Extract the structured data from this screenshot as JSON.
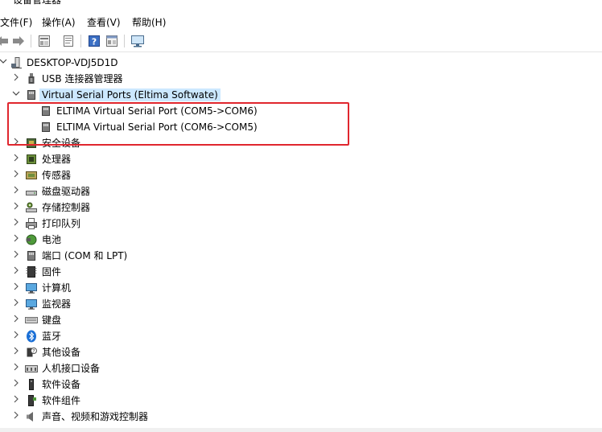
{
  "window": {
    "title": "设备管理器"
  },
  "menu": [
    {
      "label": "文件(F)"
    },
    {
      "label": "操作(A)"
    },
    {
      "label": "查看(V)"
    },
    {
      "label": "帮助(H)"
    }
  ],
  "toolbar": {
    "icons": [
      "back-arrow-icon",
      "forward-arrow-icon",
      "properties-icon",
      "update-driver-icon",
      "help-icon",
      "view-icon",
      "monitor-icon"
    ]
  },
  "tree": {
    "root": {
      "label": "DESKTOP-VDJ5D1D"
    },
    "categories": [
      {
        "label": "USB 连接器管理器",
        "expanded": false,
        "icon": "usb-icon"
      },
      {
        "label": "Virtual Serial Ports (Eltima Softwate)",
        "expanded": true,
        "icon": "port-icon",
        "children": [
          {
            "label": "ELTIMA Virtual Serial Port (COM5->COM6)"
          },
          {
            "label": "ELTIMA Virtual Serial Port (COM6->COM5)"
          }
        ]
      },
      {
        "label": "安全设备",
        "icon": "security-device-icon"
      },
      {
        "label": "处理器",
        "icon": "processor-icon"
      },
      {
        "label": "传感器",
        "icon": "sensor-icon"
      },
      {
        "label": "磁盘驱动器",
        "icon": "disk-drive-icon"
      },
      {
        "label": "存储控制器",
        "icon": "storage-controller-icon"
      },
      {
        "label": "打印队列",
        "icon": "printer-icon"
      },
      {
        "label": "电池",
        "icon": "battery-icon"
      },
      {
        "label": "端口 (COM 和 LPT)",
        "icon": "port-icon"
      },
      {
        "label": "固件",
        "icon": "firmware-icon"
      },
      {
        "label": "计算机",
        "icon": "computer-icon"
      },
      {
        "label": "监视器",
        "icon": "monitor-icon"
      },
      {
        "label": "键盘",
        "icon": "keyboard-icon"
      },
      {
        "label": "蓝牙",
        "icon": "bluetooth-icon"
      },
      {
        "label": "其他设备",
        "icon": "unknown-device-icon"
      },
      {
        "label": "人机接口设备",
        "icon": "hid-icon"
      },
      {
        "label": "软件设备",
        "icon": "software-device-icon"
      },
      {
        "label": "软件组件",
        "icon": "software-component-icon"
      },
      {
        "label": "声音、视频和游戏控制器",
        "icon": "speaker-icon"
      }
    ]
  },
  "colors": {
    "selection": "#cce8ff",
    "highlight_box": "#e0262e"
  }
}
